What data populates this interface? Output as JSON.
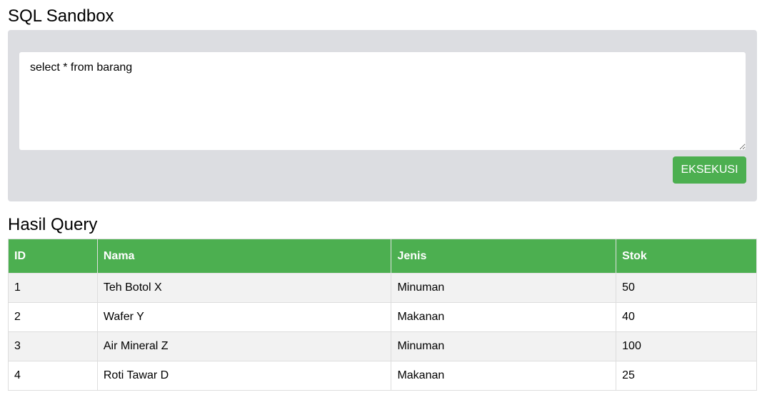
{
  "header": {
    "title": "SQL Sandbox"
  },
  "editor": {
    "query": "select * from barang",
    "execute_label": "EKSEKUSI"
  },
  "results": {
    "title": "Hasil Query",
    "columns": [
      "ID",
      "Nama",
      "Jenis",
      "Stok"
    ],
    "rows": [
      [
        "1",
        "Teh Botol X",
        "Minuman",
        "50"
      ],
      [
        "2",
        "Wafer Y",
        "Makanan",
        "40"
      ],
      [
        "3",
        "Air Mineral Z",
        "Minuman",
        "100"
      ],
      [
        "4",
        "Roti Tawar D",
        "Makanan",
        "25"
      ]
    ]
  },
  "colors": {
    "accent": "#4caf50",
    "panel_bg": "#dcdde1",
    "row_stripe": "#f2f2f2"
  }
}
